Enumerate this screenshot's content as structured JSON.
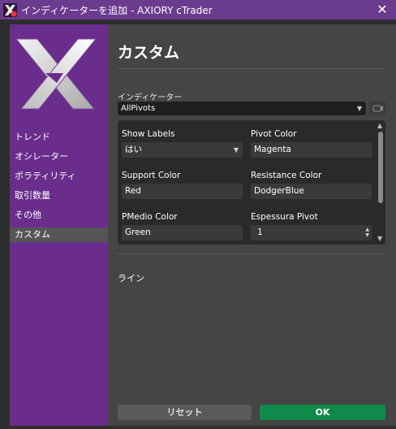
{
  "window": {
    "title": "インディケーターを追加 - AXIORY cTrader",
    "close_glyph": "✕"
  },
  "sidebar": {
    "items": [
      {
        "label": "トレンド",
        "active": false
      },
      {
        "label": "オシレーター",
        "active": false
      },
      {
        "label": "ボラティリティ",
        "active": false
      },
      {
        "label": "取引数量",
        "active": false
      },
      {
        "label": "その他",
        "active": false
      },
      {
        "label": "カスタム",
        "active": true
      }
    ]
  },
  "main": {
    "title": "カスタム",
    "indicator_label": "インディケーター",
    "indicator_value": "AllPivots",
    "params": {
      "show_labels": {
        "label": "Show Labels",
        "value": "はい"
      },
      "pivot_color": {
        "label": "Pivot Color",
        "value": "Magenta"
      },
      "support_color": {
        "label": "Support Color",
        "value": "Red"
      },
      "resistance_color": {
        "label": "Resistance Color",
        "value": "DodgerBlue"
      },
      "pmedio_color": {
        "label": "PMedio Color",
        "value": "Green"
      },
      "espessura_pivot": {
        "label": "Espessura Pivot",
        "value": "1"
      }
    },
    "line_section_label": "ライン"
  },
  "buttons": {
    "reset_label": "リセット",
    "ok_label": "OK"
  },
  "colors": {
    "titlebar": "#6b3b8f",
    "sidebar": "#6a2d8c",
    "ok_button": "#0f8a4a"
  },
  "icons": {
    "app": "axiory-x-icon",
    "logo": "axiory-x-logo",
    "close": "close-icon",
    "dropdown": "chevron-down-icon",
    "toggle": "visibility-toggle-icon"
  }
}
